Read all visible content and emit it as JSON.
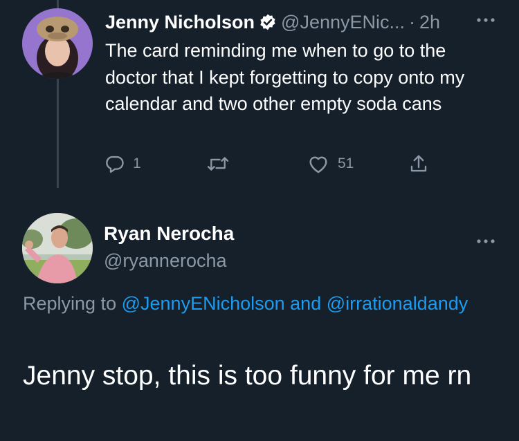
{
  "tweet": {
    "author_name": "Jenny Nicholson",
    "handle": "@JennyENic...",
    "separator": "·",
    "time": "2h",
    "verified_icon": "verified-badge-icon",
    "text": "The card reminding me when to go to the doctor that I kept forgetting to copy onto my calendar and two other empty soda cans",
    "reply_count": "1",
    "retweet_count": "",
    "like_count": "51",
    "more_icon": "more-dots-icon"
  },
  "reply": {
    "author_name": "Ryan Nerocha",
    "handle": "@ryannerocha",
    "replying_prefix": "Replying to",
    "replying_user_1": "@JennyENicholson",
    "replying_and": "and",
    "replying_user_2": "@irrationaldandy",
    "text": "Jenny stop, this is too funny for me rn",
    "more_icon": "more-dots-icon"
  },
  "colors": {
    "background": "#15202b",
    "text": "#ffffff",
    "muted": "#8b98a5",
    "link": "#1d9bf0",
    "thread_line": "#38444d"
  }
}
